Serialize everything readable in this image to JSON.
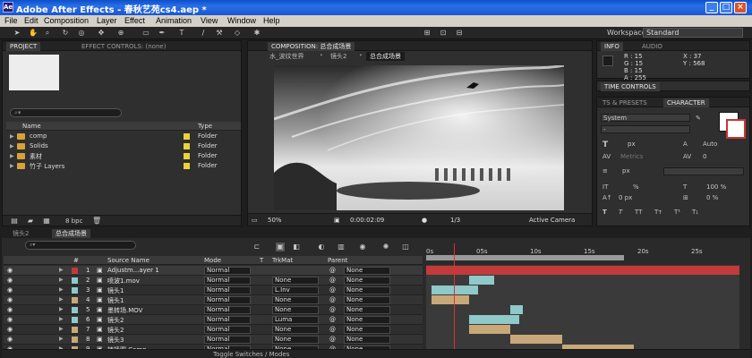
{
  "window": {
    "title": "Adobe After Effects - 春秋艺苑cs4.aep *",
    "minimize": "_",
    "maximize": "□",
    "close": "×"
  },
  "menu": [
    "File",
    "Edit",
    "Composition",
    "Layer",
    "Effect",
    "Animation",
    "View",
    "Window",
    "Help"
  ],
  "toolbar": {
    "workspace_label": "Workspace:",
    "workspace_value": "Standard"
  },
  "project": {
    "tab_project": "PROJECT",
    "tab_effect": "EFFECT CONTROLS: (none)",
    "col_name": "Name",
    "col_type": "Type",
    "items": [
      {
        "name": "comp",
        "type": "Folder"
      },
      {
        "name": "Solids",
        "type": "Folder"
      },
      {
        "name": "素材",
        "type": "Folder"
      },
      {
        "name": "竹子 Layers",
        "type": "Folder"
      }
    ],
    "bpc": "8 bpc"
  },
  "composition": {
    "tab_title": "COMPOSITION: 总合成场景",
    "breadcrumbs": [
      "水_波纹世界",
      "镜头2",
      "总合成场景"
    ],
    "zoom": "50%",
    "timecode": "0:00:02:09",
    "resolution": "1/3",
    "camera": "Active Camera"
  },
  "info": {
    "tab_info": "INFO",
    "tab_audio": "AUDIO",
    "r": "R : 15",
    "g": "G : 15",
    "b": "B : 15",
    "a": "A : 255",
    "x": "X : 37",
    "y": "Y : 568"
  },
  "time_controls": {
    "tab": "TIME CONTROLS"
  },
  "character": {
    "tab_presets": "TS & PRESETS",
    "tab_character": "CHARACTER",
    "font": "System",
    "font_size": "px",
    "leading": "Auto",
    "tracking_label": "Metrics",
    "tracking_value": "0",
    "stroke": "px",
    "vscale": "%",
    "hscale": "100 %",
    "baseline": "0 px",
    "tsume": "0 %"
  },
  "timeline": {
    "tabs": [
      "镜头2",
      "总合成场景"
    ],
    "headers": {
      "num": "#",
      "source": "Source Name",
      "mode": "Mode",
      "t": "T",
      "trkmat": "TrkMat",
      "parent": "Parent"
    },
    "ruler": [
      "0s",
      "05s",
      "10s",
      "15s",
      "20s",
      "25s"
    ],
    "layers": [
      {
        "num": "1",
        "name": "Adjustm...ayer 1",
        "mode": "Normal",
        "trkmat": "",
        "parent": "None",
        "color": "#c23a3a"
      },
      {
        "num": "2",
        "name": "喷波1.mov",
        "mode": "Normal",
        "trkmat": "None",
        "parent": "None",
        "color": "#8fc9c9"
      },
      {
        "num": "3",
        "name": "镜头1",
        "mode": "Normal",
        "trkmat": "L.Inv",
        "parent": "None",
        "color": "#8fc9c9"
      },
      {
        "num": "4",
        "name": "镜头1",
        "mode": "Normal",
        "trkmat": "None",
        "parent": "None",
        "color": "#c8a878"
      },
      {
        "num": "5",
        "name": "墨转场.MOV",
        "mode": "Normal",
        "trkmat": "None",
        "parent": "None",
        "color": "#8fc9c9"
      },
      {
        "num": "6",
        "name": "镜头2",
        "mode": "Normal",
        "trkmat": "Luma",
        "parent": "None",
        "color": "#8fc9c9"
      },
      {
        "num": "7",
        "name": "镜头2",
        "mode": "Normal",
        "trkmat": "None",
        "parent": "None",
        "color": "#c8a878"
      },
      {
        "num": "8",
        "name": "镜头3",
        "mode": "Normal",
        "trkmat": "None",
        "parent": "None",
        "color": "#c8a878"
      },
      {
        "num": "9",
        "name": "转场图 Comp",
        "mode": "Normal",
        "trkmat": "None",
        "parent": "None",
        "color": "#c8a878"
      }
    ],
    "footer": "Toggle Switches / Modes"
  }
}
